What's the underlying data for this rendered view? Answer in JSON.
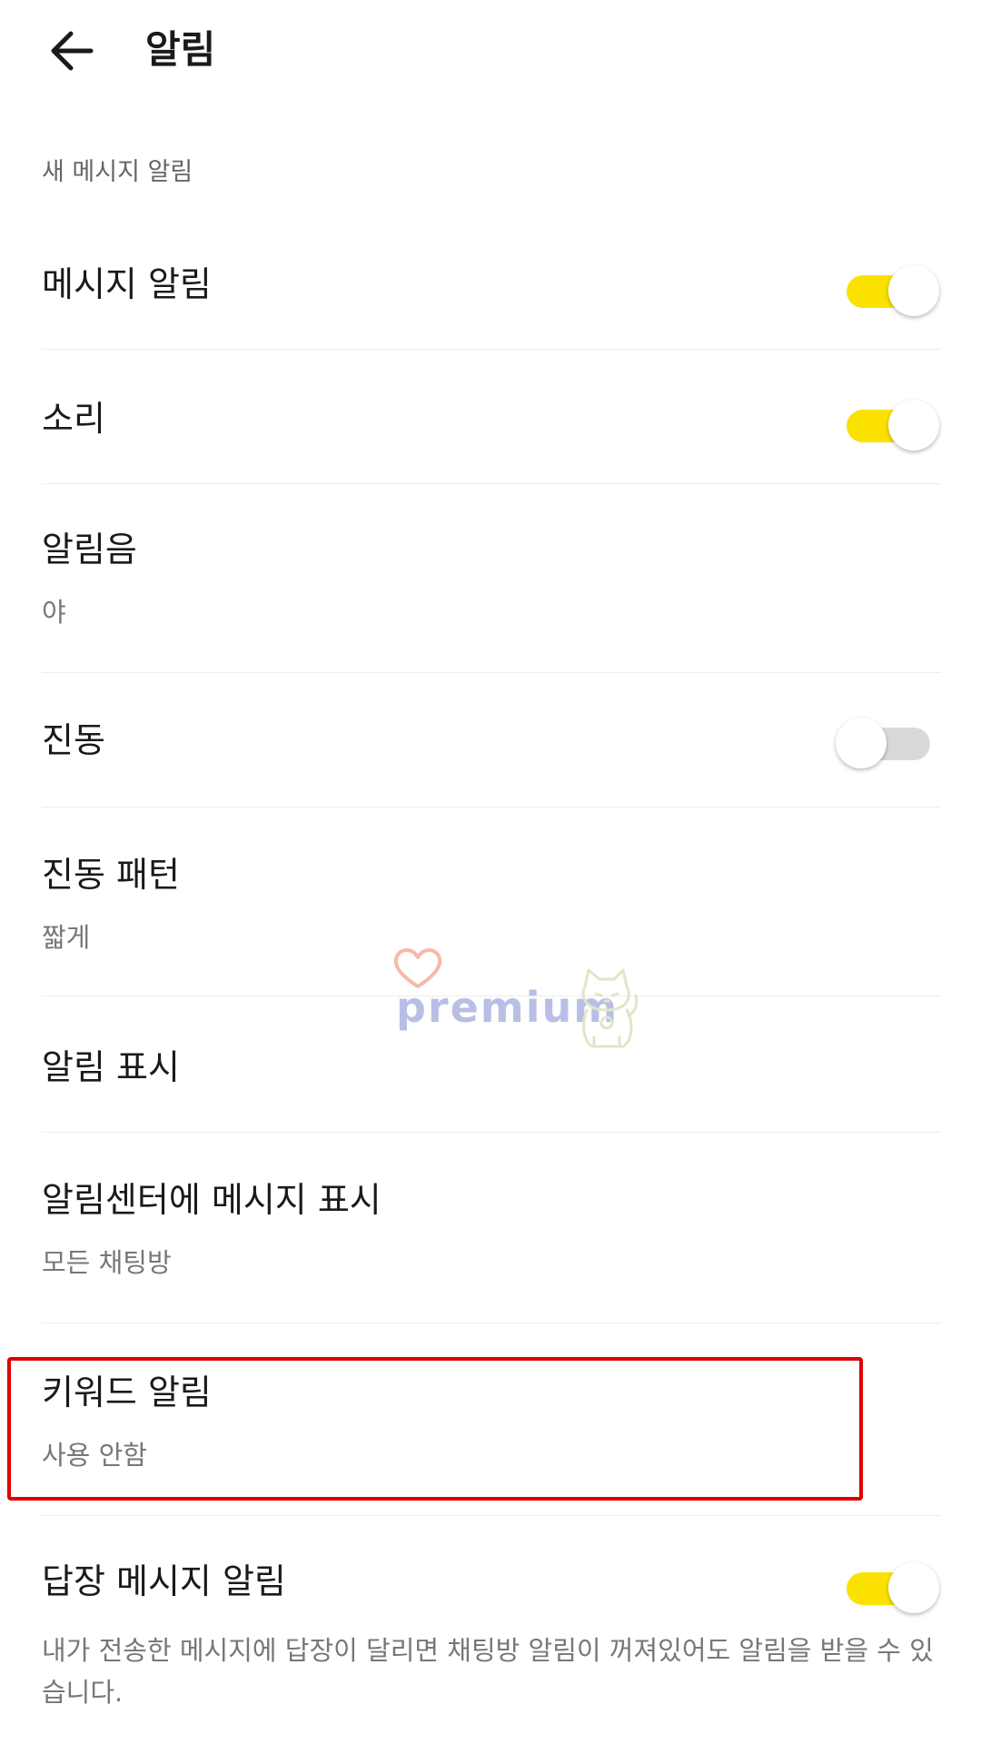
{
  "header": {
    "title": "알림"
  },
  "section": {
    "label": "새 메시지 알림"
  },
  "rows": [
    {
      "title": "메시지 알림",
      "toggle": "on"
    },
    {
      "title": "소리",
      "toggle": "on"
    },
    {
      "title": "알림음",
      "subtitle": "야"
    },
    {
      "title": "진동",
      "toggle": "off"
    },
    {
      "title": "진동 패턴",
      "subtitle": "짧게"
    },
    {
      "title": "알림 표시"
    },
    {
      "title": "알림센터에 메시지 표시",
      "subtitle": "모든 채팅방"
    },
    {
      "title": "키워드 알림",
      "subtitle": "사용 안함"
    },
    {
      "title": "답장 메시지 알림",
      "toggle": "on",
      "description": "내가 전송한 메시지에 답장이 달리면 채팅방 알림이 꺼져있어도 알림을 받을 수 있습니다."
    }
  ],
  "watermark": {
    "text": "premium"
  },
  "colors": {
    "accent": "#fae100",
    "highlight": "#e00000",
    "toggle_off": "#d9d9d9"
  },
  "icons": {
    "back": "arrow-left-icon",
    "heart": "heart-icon",
    "cat": "lucky-cat-icon"
  }
}
